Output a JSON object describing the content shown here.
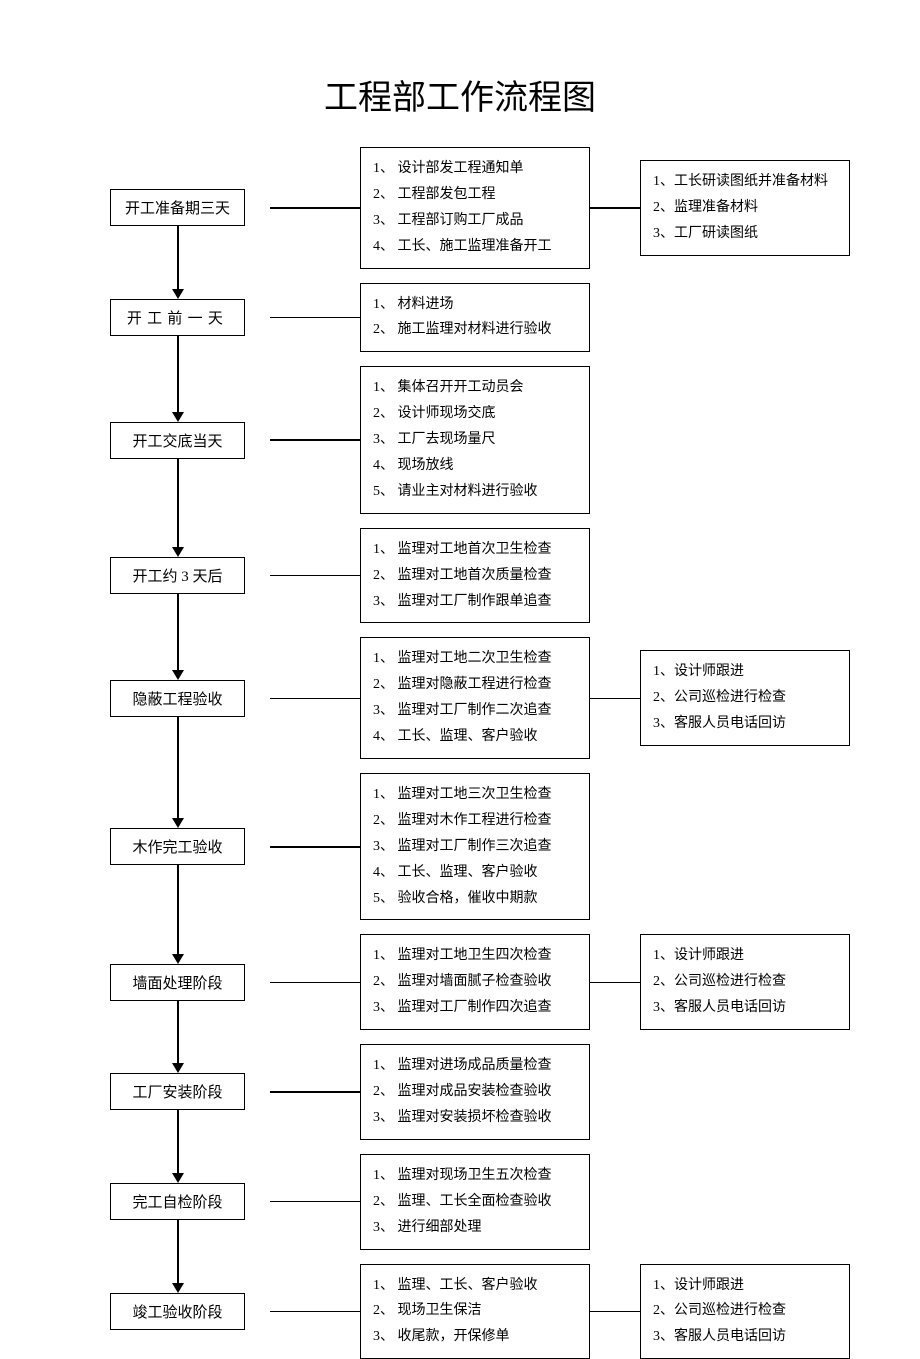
{
  "title": "工程部工作流程图",
  "stages": [
    {
      "label": "开工准备期三天",
      "spaced": false,
      "middle": [
        "设计部发工程通知单",
        "工程部发包工程",
        "工程部订购工厂成品",
        "工长、施工监理准备开工"
      ],
      "right": [
        "工长研读图纸并准备材料",
        "监理准备材料",
        "工厂研读图纸"
      ]
    },
    {
      "label": "开工前一天",
      "spaced": true,
      "middle": [
        "材料进场",
        "施工监理对材料进行验收"
      ],
      "right": null
    },
    {
      "label": "开工交底当天",
      "spaced": false,
      "middle": [
        "集体召开开工动员会",
        "设计师现场交底",
        "工厂去现场量尺",
        "现场放线",
        "请业主对材料进行验收"
      ],
      "right": null
    },
    {
      "label": "开工约 3 天后",
      "spaced": false,
      "middle": [
        "监理对工地首次卫生检查",
        "监理对工地首次质量检查",
        "监理对工厂制作跟单追查"
      ],
      "right": null
    },
    {
      "label": "隐蔽工程验收",
      "spaced": false,
      "middle": [
        "监理对工地二次卫生检查",
        "监理对隐蔽工程进行检查",
        "监理对工厂制作二次追查",
        "工长、监理、客户验收"
      ],
      "right": [
        "设计师跟进",
        "公司巡检进行检查",
        "客服人员电话回访"
      ]
    },
    {
      "label": "木作完工验收",
      "spaced": false,
      "middle": [
        "监理对工地三次卫生检查",
        "监理对木作工程进行检查",
        "监理对工厂制作三次追查",
        "工长、监理、客户验收",
        "验收合格，催收中期款"
      ],
      "right": null
    },
    {
      "label": "墙面处理阶段",
      "spaced": false,
      "middle": [
        "监理对工地卫生四次检查",
        "监理对墙面腻子检查验收",
        "监理对工厂制作四次追查"
      ],
      "right": [
        "设计师跟进",
        "公司巡检进行检查",
        "客服人员电话回访"
      ]
    },
    {
      "label": "工厂安装阶段",
      "spaced": false,
      "middle": [
        "监理对进场成品质量检查",
        "监理对成品安装检查验收",
        "监理对安装损坏检查验收"
      ],
      "right": null
    },
    {
      "label": "完工自检阶段",
      "spaced": false,
      "middle": [
        "监理对现场卫生五次检查",
        "监理、工长全面检查验收",
        "进行细部处理"
      ],
      "right": null
    },
    {
      "label": "竣工验收阶段",
      "spaced": false,
      "middle": [
        "监理、工长、客户验收",
        "现场卫生保洁",
        "收尾款，开保修单"
      ],
      "right": [
        "设计师跟进",
        "公司巡检进行检查",
        "客服人员电话回访"
      ]
    }
  ]
}
